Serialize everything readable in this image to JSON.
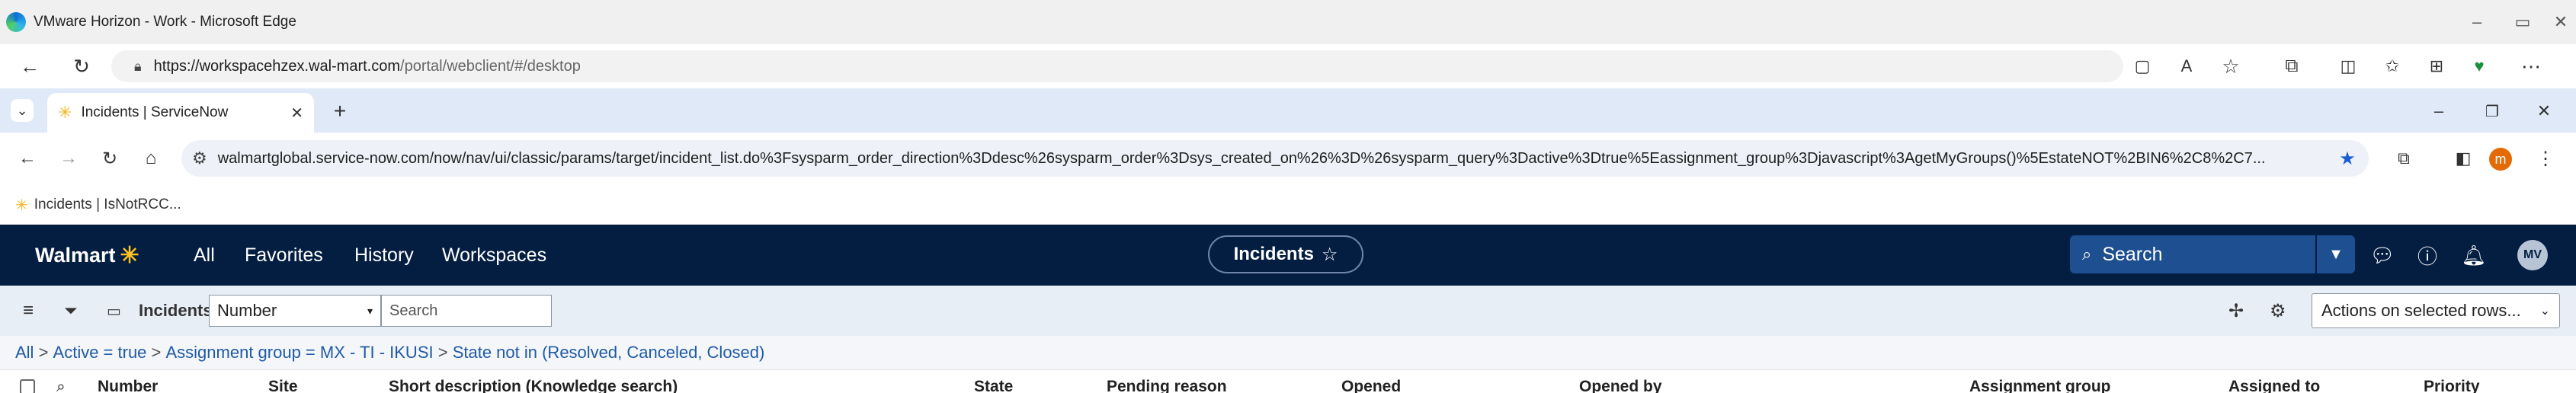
{
  "window": {
    "title": "VMware Horizon - Work - Microsoft Edge",
    "controls": [
      "–",
      "▭",
      "✕"
    ]
  },
  "outer_browser": {
    "url_host": "https://workspacehzex.wal-mart.com",
    "url_path": "/portal/webclient/#/desktop",
    "icons": [
      "back-icon",
      "refresh-icon",
      "lock-icon",
      "split-screen-icon",
      "read-aloud-icon",
      "favorite-star-icon",
      "extensions-icon",
      "split-icon",
      "favorites-icon",
      "collections-icon",
      "browser-essentials-icon",
      "more-icon"
    ]
  },
  "inner_browser": {
    "tab_label": "Incidents | ServiceNow",
    "new_tab": "+",
    "url": "walmartglobal.service-now.com/now/nav/ui/classic/params/target/incident_list.do%3Fsysparm_order_direction%3Ddesc%26sysparm_order%3Dsys_created_on%26%3D%26sysparm_query%3Dactive%3Dtrue%5Eassignment_group%3Djavascript%3AgetMyGroups()%5EstateNOT%2BIN6%2C8%2C7...",
    "profile_initial": "m",
    "bookmark_label": "Incidents | IsNotRCC..."
  },
  "servicenow_header": {
    "brand": "Walmart",
    "nav": [
      "All",
      "Favorites",
      "History",
      "Workspaces"
    ],
    "context_title": "Incidents",
    "search_label": "Search",
    "avatar_initials": "MV",
    "colors": {
      "header_bg": "#041e42",
      "spark": "#ffc220",
      "search_bg": "#1e4f90"
    }
  },
  "list_toolbar": {
    "title": "Incidents",
    "field_select": "Number",
    "search_placeholder": "Search",
    "actions_select": "Actions on selected rows..."
  },
  "breadcrumb": [
    "All",
    "Active = true",
    "Assignment group = MX - TI - IKUSI",
    "State not in (Resolved, Canceled, Closed)"
  ],
  "breadcrumb_separator": " > ",
  "columns": [
    "Number",
    "Site",
    "Short description (Knowledge search)",
    "State",
    "Pending reason",
    "Opened",
    "Opened by",
    "Assignment group",
    "Assigned to",
    "Priority"
  ]
}
